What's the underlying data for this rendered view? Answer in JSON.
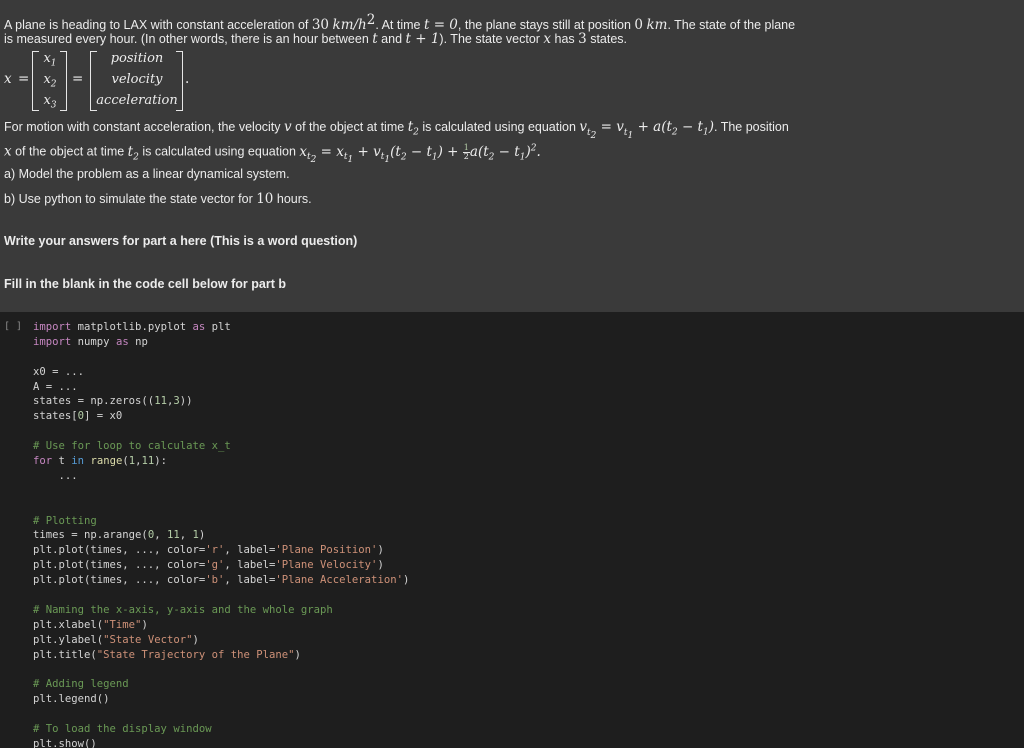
{
  "question": {
    "line1_a": "A plane is heading to LAX with constant acceleration of ",
    "accel_value": "30",
    "accel_unit": "km/h",
    "line1_b": ". At time ",
    "t_eq_0": "t = 0",
    "line1_c": ", the plane stays still at position ",
    "pos_zero": "0",
    "pos_unit": "km",
    "line1_d": ". The state of the plane",
    "line2_a": "is measured every hour. (In other words, there is an hour between ",
    "t_var": "t",
    "and_word": " and ",
    "t_plus_1": "t + 1",
    "line2_b": "). The state vector ",
    "x_var": "x",
    "line2_c": " has ",
    "num_states": "3",
    "line2_d": " states."
  },
  "matrix": {
    "x_label": "x",
    "equals": "=",
    "components": [
      "x1",
      "x2",
      "x3"
    ],
    "names": [
      "position",
      "velocity",
      "acceleration"
    ],
    "trailing": "."
  },
  "motion": {
    "line1_a": "For motion with constant acceleration, the velocity ",
    "v_var": "v",
    "line1_b": " of the object at time ",
    "line1_c": " is calculated using equation ",
    "line1_d": ". The position",
    "line2_a": " of the object at time ",
    "line2_b": " is calculated using equation "
  },
  "parts": {
    "a": "a) Model the problem as a linear dynamical system.",
    "b_pre": "b) Use python to simulate the state vector for ",
    "b_num": "10",
    "b_post": " hours."
  },
  "headings": {
    "part_a": "Write your answers for part a here (This is a word question)",
    "part_b": "Fill in the blank in the code cell below for part b"
  },
  "code_cell": {
    "run_indicator": "[ ]"
  }
}
